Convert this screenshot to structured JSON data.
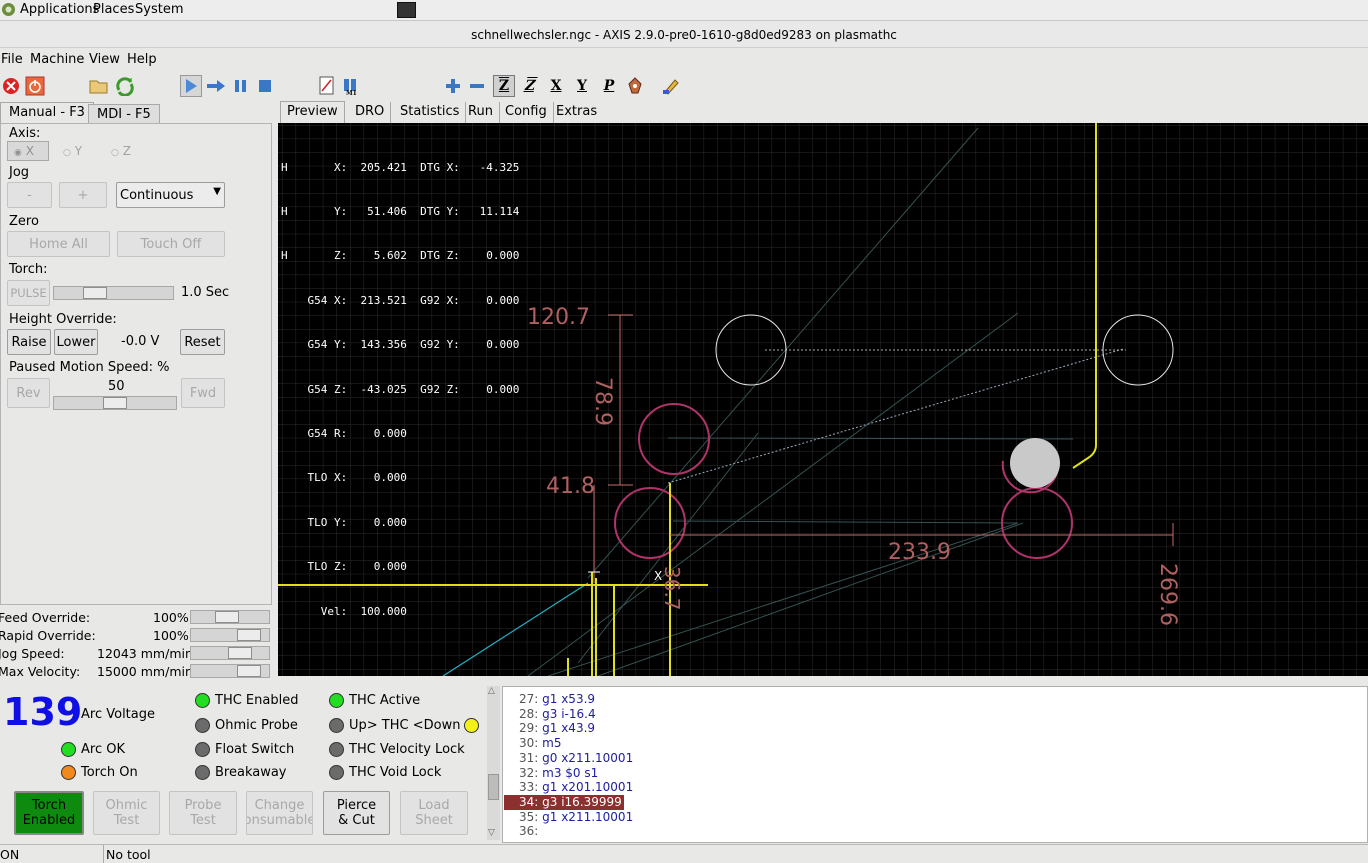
{
  "system_bar": {
    "applications": "Applications",
    "places": "Places",
    "system": "System"
  },
  "window": {
    "title": "schnellwechsler.ngc - AXIS 2.9.0-pre0-1610-g8d0ed9283 on plasmathc"
  },
  "menu": [
    "File",
    "Machine",
    "View",
    "Help"
  ],
  "toolbar": {
    "icons": [
      "estop-icon",
      "power-icon",
      "open-file-icon",
      "reload-icon",
      "run-icon",
      "step-icon",
      "pause-icon",
      "stop-icon",
      "skip-lines-icon",
      "optional-stop-icon",
      "zoom-in-icon",
      "zoom-out-icon",
      "view-z-icon",
      "view-z2-icon",
      "view-x-icon",
      "view-y-icon",
      "view-p-icon",
      "rotate-view-icon",
      "clear-plot-icon"
    ],
    "view_letters": {
      "z": "Z",
      "z2": "Z",
      "x": "X",
      "y": "Y",
      "p": "P"
    }
  },
  "left_tabs": {
    "manual": "Manual - F3",
    "mdi": "MDI - F5"
  },
  "manual": {
    "axis_label": "Axis:",
    "axis_x": "X",
    "axis_y": "Y",
    "axis_z": "Z",
    "jog_label": "Jog",
    "jog_minus": "-",
    "jog_plus": "+",
    "jog_mode": "Continuous",
    "zero_label": "Zero",
    "home_all": "Home All",
    "touch_off": "Touch Off",
    "torch_label": "Torch:",
    "pulse": "PULSE",
    "pulse_time": "1.0 Sec",
    "torch_slider": 0.3,
    "height_label": "Height Override:",
    "raise": "Raise",
    "lower": "Lower",
    "height_value": "-0.0 V",
    "reset": "Reset",
    "paused_label": "Paused Motion Speed: %",
    "paused_value": "50",
    "rev": "Rev",
    "fwd": "Fwd",
    "paused_slider": 0.5
  },
  "overrides": [
    {
      "label": "Feed Override:",
      "value": "100",
      "unit": "%",
      "level": 0.45
    },
    {
      "label": "Rapid Override:",
      "value": "100",
      "unit": "%",
      "level": 0.85
    },
    {
      "label": "Jog Speed:",
      "value": "12043",
      "unit": "mm/min",
      "level": 0.68
    },
    {
      "label": "Max Velocity:",
      "value": "15000",
      "unit": "mm/min",
      "level": 0.85
    }
  ],
  "right_tabs": [
    "Preview",
    "DRO",
    "Statistics",
    "Run",
    "Config",
    "Extras"
  ],
  "dro": [
    "H       X:  205.421  DTG X:   -4.325",
    "H       Y:   51.406  DTG Y:   11.114",
    "H       Z:    5.602  DTG Z:    0.000",
    "    G54 X:  213.521  G92 X:    0.000",
    "    G54 Y:  143.356  G92 Y:    0.000",
    "    G54 Z:  -43.025  G92 Z:    0.000",
    "    G54 R:    0.000",
    "    TLO X:    0.000",
    "    TLO Y:    0.000",
    "    TLO Z:    0.000",
    "      Vel:  100.000"
  ],
  "dimensions": {
    "d1": "120.7",
    "d2": "78.9",
    "d3": "41.8",
    "d4": "233.9",
    "d5": "269.6",
    "d6": "36.7"
  },
  "arc": {
    "voltage": "139",
    "label": "Arc Voltage"
  },
  "leds": {
    "thc_enabled": "THC Enabled",
    "thc_active": "THC Active",
    "ohmic_probe": "Ohmic Probe",
    "up_thc_down": "Up> THC <Down",
    "arc_ok": "Arc OK",
    "float_switch": "Float Switch",
    "thc_velocity_lock": "THC Velocity Lock",
    "torch_on": "Torch On",
    "breakaway": "Breakaway",
    "thc_void_lock": "THC Void Lock"
  },
  "led_colors": {
    "green": "#22dd22",
    "gray": "#6b6b6b",
    "orange": "#f08a1c",
    "yellow": "#f2f21a"
  },
  "buttons": {
    "torch_1": "Torch",
    "torch_2": "Enabled",
    "ohmic_1": "Ohmic",
    "ohmic_2": "Test",
    "probe_1": "Probe",
    "probe_2": "Test",
    "change_1": "Change",
    "change_2": "onsumable",
    "pierce_1": "Pierce",
    "pierce_2": "& Cut",
    "load_1": "Load",
    "load_2": "Sheet"
  },
  "gcode": [
    {
      "n": "27:",
      "c": "g1 x53.9"
    },
    {
      "n": "28:",
      "c": "g3 i-16.4"
    },
    {
      "n": "29:",
      "c": "g1 x43.9"
    },
    {
      "n": "30:",
      "c": "m5"
    },
    {
      "n": "31:",
      "c": "g0 x211.10001"
    },
    {
      "n": "32:",
      "c": "m3 $0 s1"
    },
    {
      "n": "33:",
      "c": "g1 x201.10001"
    },
    {
      "n": "34:",
      "c": "g3 i16.39999"
    },
    {
      "n": "35:",
      "c": "g1 x211.10001"
    },
    {
      "n": "36:",
      "c": ""
    }
  ],
  "status": {
    "state": "ON",
    "tool": "No tool"
  }
}
